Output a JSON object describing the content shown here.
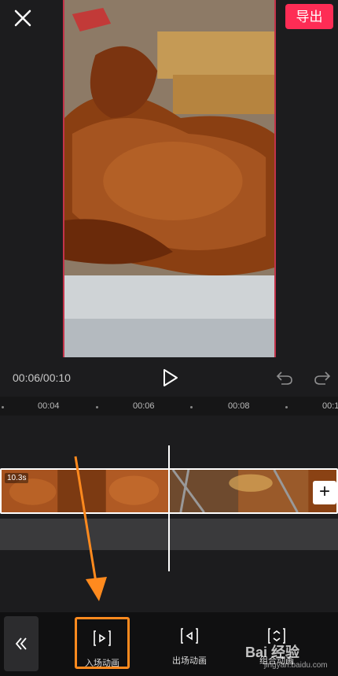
{
  "header": {
    "export_label": "导出"
  },
  "playback": {
    "time": "00:06/00:10"
  },
  "ruler": {
    "ticks": [
      "00:04",
      "00:06",
      "00:08",
      "00:1"
    ]
  },
  "timeline": {
    "clip_duration": "10.3s",
    "add_label": "+"
  },
  "toolbar": {
    "items": [
      {
        "label": "入场动画",
        "icon": "enter-animation-icon",
        "active": true
      },
      {
        "label": "出场动画",
        "icon": "exit-animation-icon",
        "active": false
      },
      {
        "label": "组合动画",
        "icon": "combo-animation-icon",
        "active": false
      }
    ]
  },
  "annotation": {
    "color": "#ff8a1e"
  },
  "watermark": {
    "brand": "Bai 经验",
    "url": "jingyan.baidu.com"
  },
  "colors": {
    "accent": "#fe2c55",
    "highlight": "#ff8a1e",
    "background": "#1c1c1e"
  }
}
